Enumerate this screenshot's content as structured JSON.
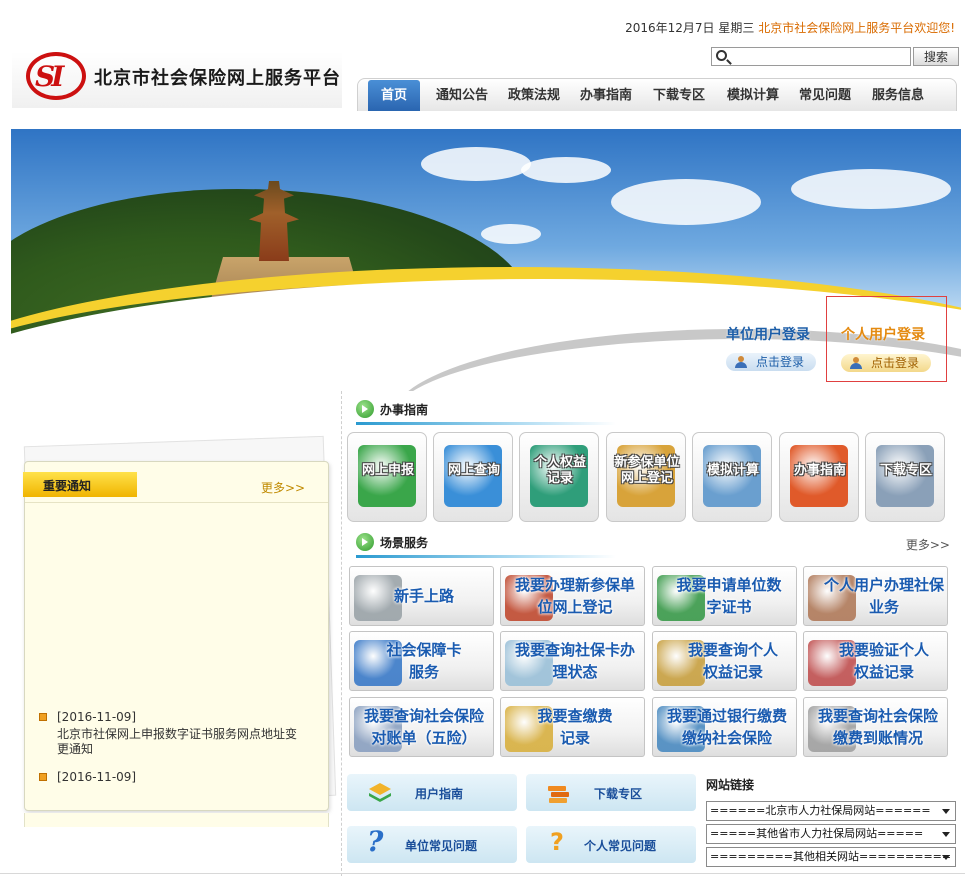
{
  "header": {
    "date": "2016年12月7日 星期三",
    "welcome": "北京市社会保险网上服务平台欢迎您!",
    "logo_mark": "SI",
    "logo_text": "北京市社会保险网上服务平台",
    "search": {
      "placeholder": "",
      "button_label": "搜索"
    },
    "nav": [
      {
        "label": "首页",
        "active": true
      },
      {
        "label": "通知公告"
      },
      {
        "label": "政策法规"
      },
      {
        "label": "办事指南"
      },
      {
        "label": "下载专区"
      },
      {
        "label": "模拟计算"
      },
      {
        "label": "常见问题"
      },
      {
        "label": "服务信息"
      }
    ]
  },
  "login": {
    "unit": {
      "title": "单位用户登录",
      "button": "点击登录"
    },
    "personal": {
      "title": "个人用户登录",
      "button": "点击登录"
    }
  },
  "notices": {
    "title": "重要通知",
    "more": "更多>>",
    "items": [
      {
        "date": "[2016-11-09]",
        "text": "北京市社保网上申报数字证书服务网点地址变更通知"
      },
      {
        "date": "[2016-11-09]",
        "text": ""
      }
    ]
  },
  "guide": {
    "title": "办事指南",
    "tiles": [
      {
        "label": "网上申报",
        "color": "#3aa64a"
      },
      {
        "label": "网上查询",
        "color": "#3a8fd8"
      },
      {
        "label": "个人权益记录",
        "color": "#2f9e7a"
      },
      {
        "label": "新参保单位网上登记",
        "color": "#d8a33a"
      },
      {
        "label": "模拟计算",
        "color": "#6a9fcf"
      },
      {
        "label": "办事指南",
        "color": "#e05a2a"
      },
      {
        "label": "下载专区",
        "color": "#8aa0b8"
      }
    ]
  },
  "scenes": {
    "title": "场景服务",
    "more": "更多>>",
    "cards": [
      {
        "label": "新手上路",
        "color": "#9aa3a8"
      },
      {
        "label": "我要办理新参保单位网上登记",
        "color": "#c04a30"
      },
      {
        "label": "我要申请单位数字证书",
        "color": "#3a9a4a"
      },
      {
        "label": "个人用户办理社保业务",
        "color": "#b07a5a"
      },
      {
        "label": "社会保障卡服务",
        "color": "#3a7ac8"
      },
      {
        "label": "我要查询社保卡办理状态",
        "color": "#9ac0d8"
      },
      {
        "label": "我要查询个人权益记录",
        "color": "#c8a040"
      },
      {
        "label": "我要验证个人权益记录",
        "color": "#c05050"
      },
      {
        "label": "我要查询社会保险对账单（五险）",
        "color": "#8aa0c0"
      },
      {
        "label": "我要查缴费记录",
        "color": "#d8b040"
      },
      {
        "label": "我要通过银行缴费缴纳社会保险",
        "color": "#4a8ac0"
      },
      {
        "label": "我要查询社会保险缴费到账情况",
        "color": "#a0a0a0"
      }
    ]
  },
  "bottom": {
    "user_guide": "用户指南",
    "download": "下载专区",
    "unit_faq": "单位常见问题",
    "personal_faq": "个人常见问题"
  },
  "links": {
    "title": "网站链接",
    "selects": [
      "======北京市人力社保局网站======",
      "=====其他省市人力社保局网站=====",
      "=========其他相关网站=========="
    ]
  },
  "colors": {
    "nav_active": "#2a65b0",
    "accent_blue": "#1a5bb0",
    "welcome_orange": "#d96b00",
    "notice_yellow": "#f0b400",
    "login_highlight_border": "#e04040"
  }
}
